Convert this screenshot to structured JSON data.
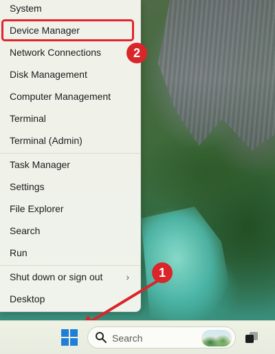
{
  "menu": {
    "items": [
      {
        "label": "System"
      },
      {
        "label": "Device Manager"
      },
      {
        "label": "Network Connections"
      },
      {
        "label": "Disk Management"
      },
      {
        "label": "Computer Management"
      },
      {
        "label": "Terminal"
      },
      {
        "label": "Terminal (Admin)"
      },
      {
        "label": "Task Manager"
      },
      {
        "label": "Settings"
      },
      {
        "label": "File Explorer"
      },
      {
        "label": "Search"
      },
      {
        "label": "Run"
      },
      {
        "label": "Shut down or sign out",
        "submenu_icon": "chevron-right-icon"
      },
      {
        "label": "Desktop"
      }
    ]
  },
  "annotations": {
    "step1": "1",
    "step2": "2",
    "highlight_color": "#e0242b"
  },
  "taskbar": {
    "start_icon": "windows-logo-icon",
    "search": {
      "label": "Search",
      "icon": "search-icon"
    },
    "task_view_icon": "task-view-icon"
  }
}
